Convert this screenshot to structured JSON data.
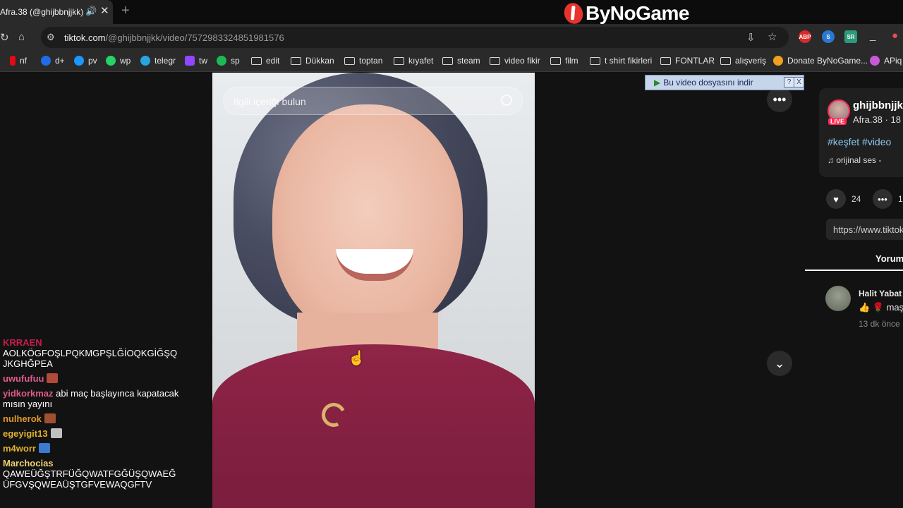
{
  "browser": {
    "tab_title": "Afra.38 (@ghijbbnjjkk) |",
    "new_tab": "+",
    "url_domain": "tiktok.com",
    "url_path": "/@ghijbbnjjkk/video/7572983324851981576",
    "logo_text": "ByNoGame",
    "extensions": [
      "ABP",
      "S",
      "SR"
    ]
  },
  "bookmarks": [
    {
      "label": "nf",
      "icon": "netflix-icon",
      "color": "#e50914"
    },
    {
      "label": "d+",
      "icon": "disney-icon",
      "color": "#1f6ee8"
    },
    {
      "label": "pv",
      "icon": "prime-video-icon",
      "color": "#1a98ff"
    },
    {
      "label": "wp",
      "icon": "whatsapp-icon",
      "color": "#25d366"
    },
    {
      "label": "telegr",
      "icon": "telegram-icon",
      "color": "#2aa3df"
    },
    {
      "label": "tw",
      "icon": "twitch-icon",
      "color": "#9146ff"
    },
    {
      "label": "sp",
      "icon": "spotify-icon",
      "color": "#1db954"
    },
    {
      "label": "edit",
      "icon": "folder-icon"
    },
    {
      "label": "Dükkan",
      "icon": "folder-icon"
    },
    {
      "label": "toptan",
      "icon": "folder-icon"
    },
    {
      "label": "kıyafet",
      "icon": "folder-icon"
    },
    {
      "label": "steam",
      "icon": "folder-icon"
    },
    {
      "label": "video fikir",
      "icon": "folder-icon"
    },
    {
      "label": "film",
      "icon": "folder-icon"
    },
    {
      "label": "t shirt fikirleri",
      "icon": "folder-icon"
    },
    {
      "label": "FONTLAR",
      "icon": "folder-icon"
    },
    {
      "label": "alışveriş",
      "icon": "folder-icon"
    },
    {
      "label": "Donate ByNoGame...",
      "icon": "bynogame-icon",
      "color": "#f0a020"
    },
    {
      "label": "APiq",
      "icon": "apiq-icon",
      "color": "#c85ad8"
    }
  ],
  "video": {
    "search_placeholder": "İlgili içeriği bulun"
  },
  "download_bar": {
    "label": "Bu video dosyasını indir",
    "help": "?",
    "close": "X"
  },
  "author": {
    "name": "ghijbbnjjk",
    "live": "LIVE",
    "sub": "Afra.38 · 18",
    "hashtags": "#keşfet #video",
    "music": "♫ orijinal ses -"
  },
  "stats": {
    "likes": "24",
    "comments": "1"
  },
  "link": "https://www.tiktok",
  "comments_tab": "Yorum",
  "comment": {
    "user": "Halit Yabat",
    "text": "👍 🌹 maş",
    "time": "13 dk önce"
  },
  "chat": [
    {
      "user": "KRRAEN",
      "color": "#c81d4b",
      "text": "AOLKÖGFOŞLPQKMGPŞLĞİOQKGİĞŞQJKGHĞPEA",
      "newline": true
    },
    {
      "user": "uwufufuu",
      "color": "#e05a8c",
      "text": "",
      "emote": "#b04a3a"
    },
    {
      "user": "yidkorkmaz",
      "color": "#e05a8c",
      "text": "abi maç başlayınca kapatacak mısın yayını"
    },
    {
      "user": "nulherok",
      "color": "#e0982a",
      "text": "",
      "emote": "#a05030"
    },
    {
      "user": "egeyigit13",
      "color": "#e0b030",
      "text": "",
      "emote": "#c0c0c0"
    },
    {
      "user": "m4worr",
      "color": "#e0b030",
      "text": "",
      "emote": "#3a7ad0"
    },
    {
      "user": "Marchocias",
      "color": "#f0d070",
      "text": "QAWEÜĞŞTRFÜĞQWATFGĞÜŞQWAEĞÜFGVŞQWEAÜŞTGFVEWAQGFTV",
      "newline": true
    }
  ]
}
